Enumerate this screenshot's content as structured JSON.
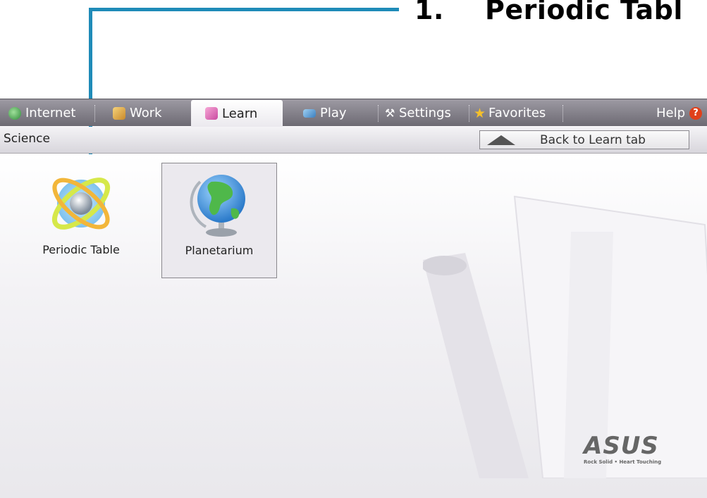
{
  "callout": {
    "number": "1.",
    "title": "Periodic Tabl"
  },
  "tabs": [
    {
      "label": "Internet",
      "icon": "globe-icon"
    },
    {
      "label": "Work",
      "icon": "work-icon"
    },
    {
      "label": "Learn",
      "icon": "learn-icon",
      "active": true
    },
    {
      "label": "Play",
      "icon": "play-icon"
    },
    {
      "label": "Settings",
      "icon": "wrench-icon"
    },
    {
      "label": "Favorites",
      "icon": "star-icon"
    }
  ],
  "help_label": "Help",
  "help_icon_glyph": "?",
  "subbar": {
    "title": "Science",
    "back_label": "Back to Learn tab"
  },
  "apps": [
    {
      "label": "Periodic Table",
      "icon": "atom-icon"
    },
    {
      "label": "Planetarium",
      "icon": "globe-stand-icon",
      "selected": true
    }
  ],
  "brand": {
    "logo": "ASUS",
    "tagline": "Rock Solid • Heart Touching"
  },
  "colors": {
    "accent_arrow": "#1f8bb8",
    "tabbar": "#7a7780",
    "help": "#e0401a"
  }
}
